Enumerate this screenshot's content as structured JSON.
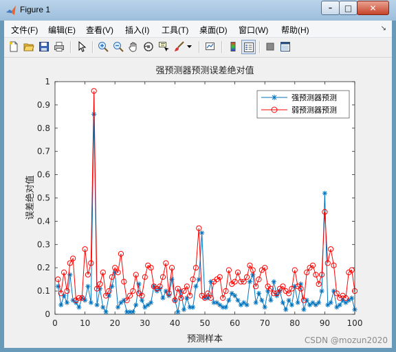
{
  "window": {
    "title": "Figure 1",
    "minimize_glyph": "–",
    "maximize_glyph": "□",
    "close_glyph": "✕"
  },
  "menubar": {
    "items": [
      "文件(F)",
      "编辑(E)",
      "查看(V)",
      "插入(I)",
      "工具(T)",
      "桌面(D)",
      "窗口(W)",
      "帮助(H)"
    ],
    "dock_glyph": "↘"
  },
  "toolbar": {
    "icons": [
      "new-figure-icon",
      "open-file-icon",
      "save-icon",
      "print-icon",
      "edit-plot-arrow-icon",
      "zoom-in-icon",
      "zoom-out-icon",
      "pan-hand-icon",
      "rotate-3d-icon",
      "data-cursor-icon",
      "brush-icon",
      "link-plot-icon",
      "colorbar-icon",
      "legend-icon",
      "hide-plot-tools-icon",
      "show-plot-tools-icon"
    ]
  },
  "watermark": "CSDN @mozun2020",
  "chart_data": {
    "type": "line",
    "title": "强预测器预测误差绝对值",
    "xlabel": "预测样本",
    "ylabel": "误差绝对值",
    "xlim": [
      0,
      100
    ],
    "ylim": [
      0,
      1
    ],
    "xticks": [
      0,
      10,
      20,
      30,
      40,
      50,
      60,
      70,
      80,
      90,
      100
    ],
    "yticks": [
      0,
      0.1,
      0.2,
      0.3,
      0.4,
      0.5,
      0.6,
      0.7,
      0.8,
      0.9,
      1
    ],
    "xtick_labels": [
      "0",
      "10",
      "20",
      "30",
      "40",
      "50",
      "60",
      "70",
      "80",
      "90",
      "100"
    ],
    "ytick_labels": [
      "0",
      "0.1",
      "0.2",
      "0.3",
      "0.4",
      "0.5",
      "0.6",
      "0.7",
      "0.8",
      "0.9",
      "1"
    ],
    "legend_position": "top-right",
    "grid": false,
    "x": [
      1,
      2,
      3,
      4,
      5,
      6,
      7,
      8,
      9,
      10,
      11,
      12,
      13,
      14,
      15,
      16,
      17,
      18,
      19,
      20,
      21,
      22,
      23,
      24,
      25,
      26,
      27,
      28,
      29,
      30,
      31,
      32,
      33,
      34,
      35,
      36,
      37,
      38,
      39,
      40,
      41,
      42,
      43,
      44,
      45,
      46,
      47,
      48,
      49,
      50,
      51,
      52,
      53,
      54,
      55,
      56,
      57,
      58,
      59,
      60,
      61,
      62,
      63,
      64,
      65,
      66,
      67,
      68,
      69,
      70,
      71,
      72,
      73,
      74,
      75,
      76,
      77,
      78,
      79,
      80,
      81,
      82,
      83,
      84,
      85,
      86,
      87,
      88,
      89,
      90,
      91,
      92,
      93,
      94,
      95,
      96,
      97,
      98,
      99,
      100
    ],
    "series": [
      {
        "name": "强预测器预测",
        "color": "#0072bd",
        "marker": "asterisk",
        "values": [
          0.12,
          0.04,
          0.08,
          0.05,
          0.17,
          0.06,
          0.05,
          0.03,
          0.07,
          0.06,
          0.12,
          0.05,
          0.86,
          0.04,
          0.11,
          0.03,
          0.01,
          0.08,
          0.12,
          0.18,
          0.03,
          0.05,
          0.06,
          0.01,
          0.01,
          0.01,
          0.04,
          0.13,
          0.06,
          0.03,
          0.04,
          0.05,
          0.12,
          0.1,
          0.11,
          0.07,
          0.1,
          0.08,
          0.15,
          0.06,
          0.01,
          0.1,
          0.02,
          0.07,
          0.03,
          0.03,
          0.12,
          0.15,
          0.35,
          0.07,
          0.07,
          0.14,
          0.05,
          0.05,
          0.04,
          0.03,
          0.03,
          0.06,
          0.09,
          0.08,
          0.06,
          0.04,
          0.05,
          0.04,
          0.14,
          0.17,
          0.05,
          0.09,
          0.06,
          0.03,
          0.1,
          0.06,
          0.14,
          0.08,
          0.1,
          0.05,
          0.02,
          0.06,
          0.04,
          0.12,
          0.05,
          0.13,
          0.02,
          0.06,
          0.04,
          0.05,
          0.04,
          0.05,
          0.1,
          0.52,
          0.04,
          0.05,
          0.1,
          0.03,
          0.04,
          0.06,
          0.05,
          0.06,
          0.07,
          0.02
        ]
      },
      {
        "name": "弱预测器预测",
        "color": "#ff0000",
        "marker": "circle",
        "values": [
          0.15,
          0.09,
          0.18,
          0.1,
          0.22,
          0.24,
          0.06,
          0.07,
          0.07,
          0.28,
          0.17,
          0.22,
          0.96,
          0.11,
          0.13,
          0.18,
          0.08,
          0.1,
          0.16,
          0.2,
          0.18,
          0.26,
          0.14,
          0.06,
          0.08,
          0.1,
          0.17,
          0.09,
          0.08,
          0.16,
          0.21,
          0.2,
          0.12,
          0.11,
          0.12,
          0.16,
          0.22,
          0.09,
          0.2,
          0.06,
          0.11,
          0.07,
          0.1,
          0.12,
          0.08,
          0.15,
          0.2,
          0.37,
          0.08,
          0.07,
          0.09,
          0.07,
          0.14,
          0.15,
          0.16,
          0.07,
          0.1,
          0.19,
          0.13,
          0.14,
          0.18,
          0.14,
          0.14,
          0.16,
          0.21,
          0.19,
          0.12,
          0.15,
          0.19,
          0.2,
          0.12,
          0.11,
          0.09,
          0.09,
          0.11,
          0.12,
          0.1,
          0.09,
          0.11,
          0.19,
          0.12,
          0.11,
          0.06,
          0.18,
          0.2,
          0.21,
          0.17,
          0.13,
          0.17,
          0.44,
          0.22,
          0.28,
          0.21,
          0.09,
          0.07,
          0.08,
          0.07,
          0.18,
          0.19,
          0.1
        ]
      }
    ]
  }
}
